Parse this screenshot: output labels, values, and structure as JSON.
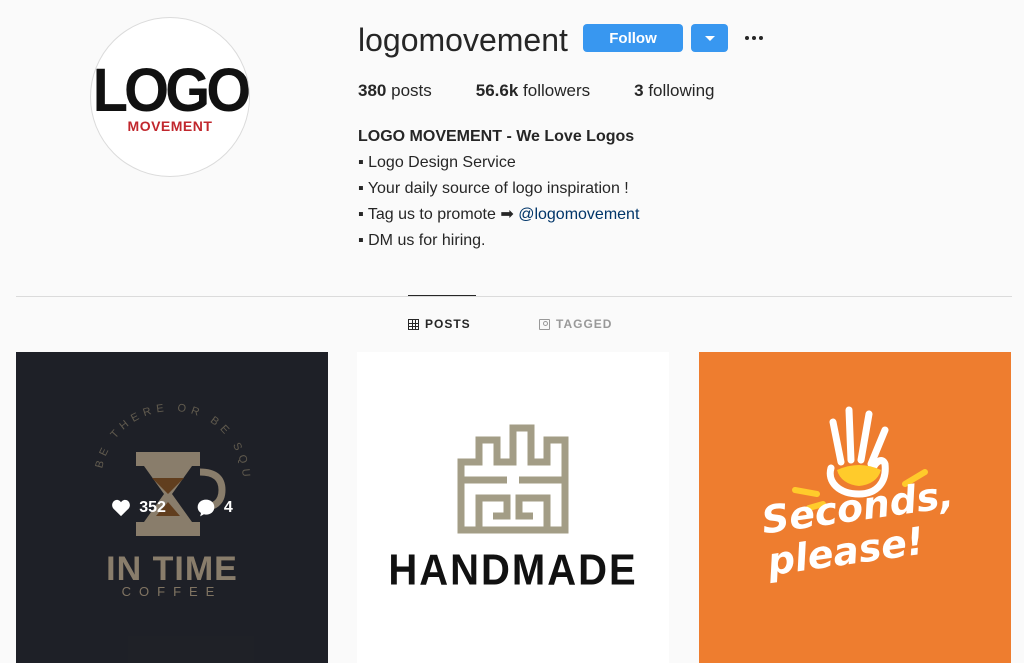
{
  "profile": {
    "username": "logomovement",
    "avatar_logo_top": "LOGO",
    "avatar_logo_bottom": "MOVEMENT",
    "follow_label": "Follow",
    "stats": {
      "posts_count": "380",
      "posts_label": "posts",
      "followers_count": "56.6k",
      "followers_label": "followers",
      "following_count": "3",
      "following_label": "following"
    },
    "bio": {
      "name": "LOGO MOVEMENT - We Love Logos",
      "line1": "▪ Logo Design Service",
      "line2": "▪ Your daily source of logo inspiration !",
      "line3_prefix": "▪ Tag us to promote ➡ ",
      "line3_mention": "@logomovement",
      "line4": "▪ DM us for hiring."
    }
  },
  "tabs": {
    "posts": "POSTS",
    "tagged": "TAGGED"
  },
  "posts": [
    {
      "image_main_text": "IN TIME",
      "image_sub_text": "COFFEE",
      "image_ring_text": "BE THERE OR BE SQUARE",
      "likes": "352",
      "comments": "4",
      "hovered": true
    },
    {
      "image_main_text": "HANDMADE"
    },
    {
      "image_main_text": "Seconds, please!"
    }
  ],
  "colors": {
    "accent": "#3897f0",
    "mention": "#003569",
    "logo_red": "#c1272d",
    "post1_bg": "#2c2f38",
    "post3_bg": "#ee7d2f",
    "handmade_gold": "#a39d86"
  },
  "icons": [
    "chevron-down-icon",
    "more-icon",
    "grid-icon",
    "tag-icon",
    "heart-icon",
    "comment-icon"
  ]
}
